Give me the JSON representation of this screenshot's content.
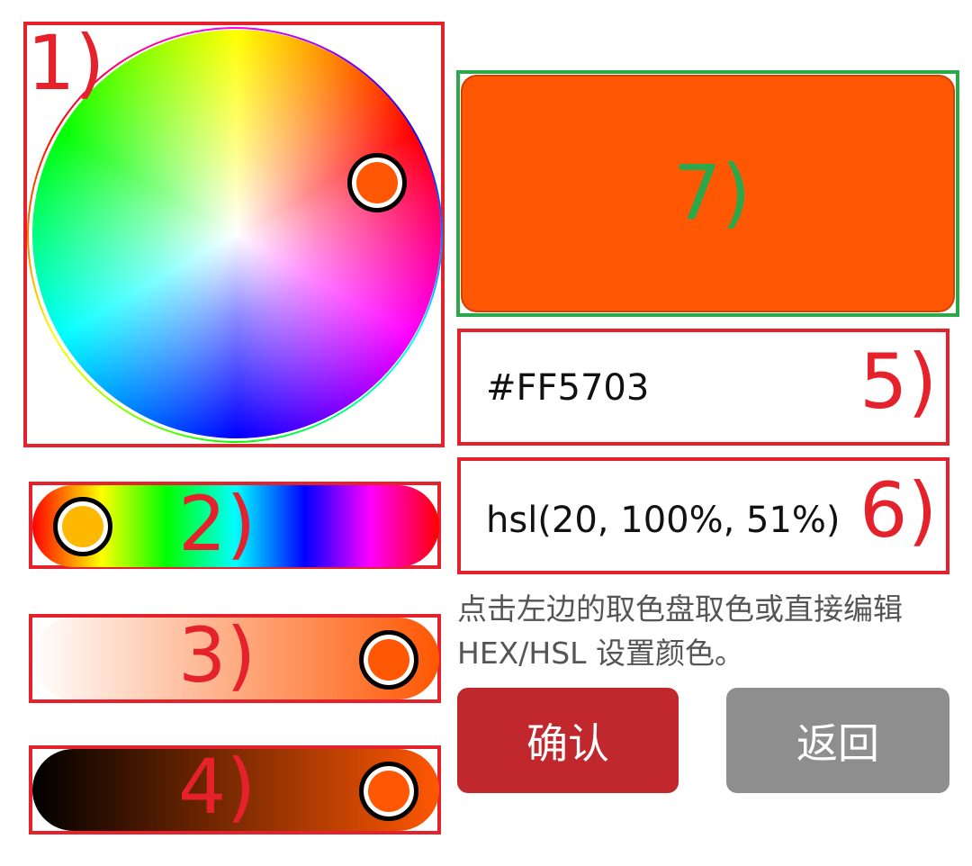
{
  "colors": {
    "selected": "#FF5703",
    "annotation_red": "#e5222c",
    "annotation_green": "#2aa84a",
    "confirm_button": "#c0282e",
    "back_button": "#8e8e8e"
  },
  "annotations": {
    "wheel": "1)",
    "hue_slider": "2)",
    "saturation_slider": "3)",
    "lightness_slider": "4)",
    "hex_field": "5)",
    "hsl_field": "6)",
    "preview": "7)"
  },
  "hsl": {
    "hue": 20,
    "saturation_percent": 100,
    "lightness_percent": 51
  },
  "sliders": {
    "hue_level": 0.06,
    "saturation_level": 0.94,
    "lightness_level": 0.94
  },
  "fields": {
    "hex_value": "#FF5703",
    "hsl_value": "hsl(20, 100%, 51%)"
  },
  "hint_text": "点击左边的取色盘取色或直接编辑 HEX/HSL 设置颜色。",
  "buttons": {
    "confirm_label": "确认",
    "back_label": "返回"
  }
}
